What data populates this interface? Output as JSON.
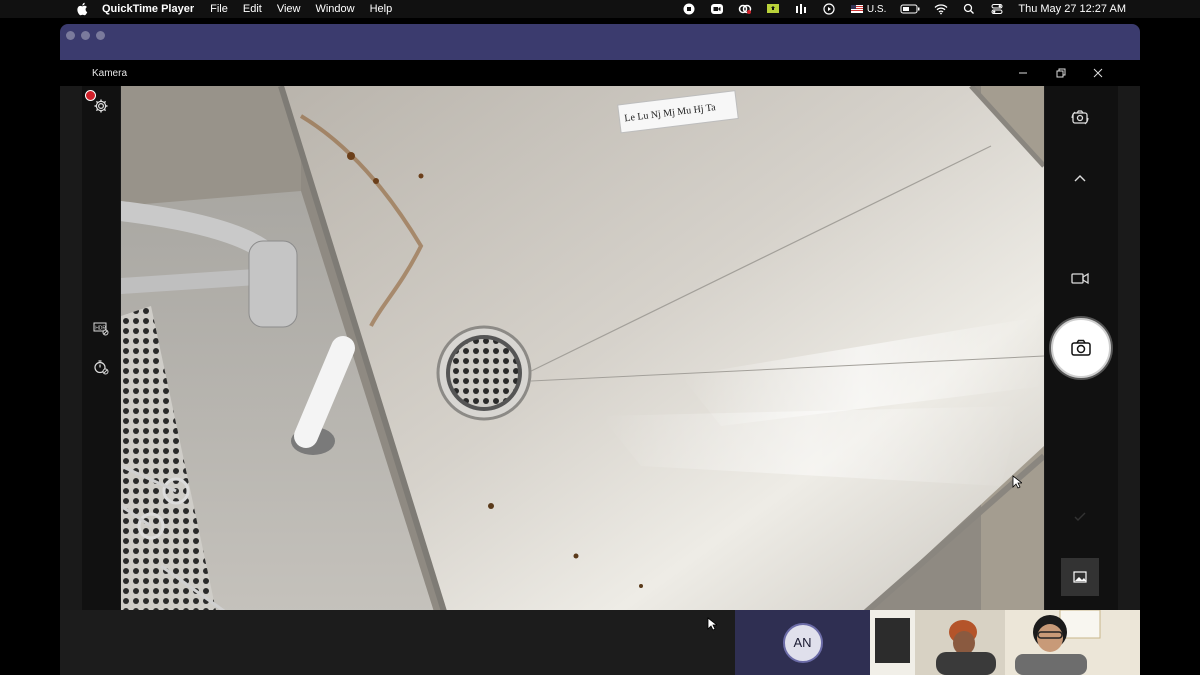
{
  "menubar": {
    "app_name": "QuickTime Player",
    "menus": [
      "File",
      "Edit",
      "View",
      "Window",
      "Help"
    ],
    "input_source": "U.S.",
    "clock": "Thu May 27  12:27 AM"
  },
  "kamera": {
    "title": "Kamera"
  },
  "scene": {
    "label_tag": "Le Lu Nj Mj Mu Hj Ta"
  },
  "call": {
    "participant_initials": "AN"
  },
  "colors": {
    "titlebar": "#3b3b6e",
    "record": "#d0202a",
    "avatar_tile": "#2f2f52"
  },
  "icons": {
    "settings": "gear-icon",
    "hdr": "hdr-off-icon",
    "timer": "timer-off-icon",
    "switch_camera": "switch-camera-icon",
    "expand": "chevron-up-icon",
    "video_mode": "video-camera-icon",
    "photo": "camera-icon",
    "gallery": "gallery-icon"
  }
}
